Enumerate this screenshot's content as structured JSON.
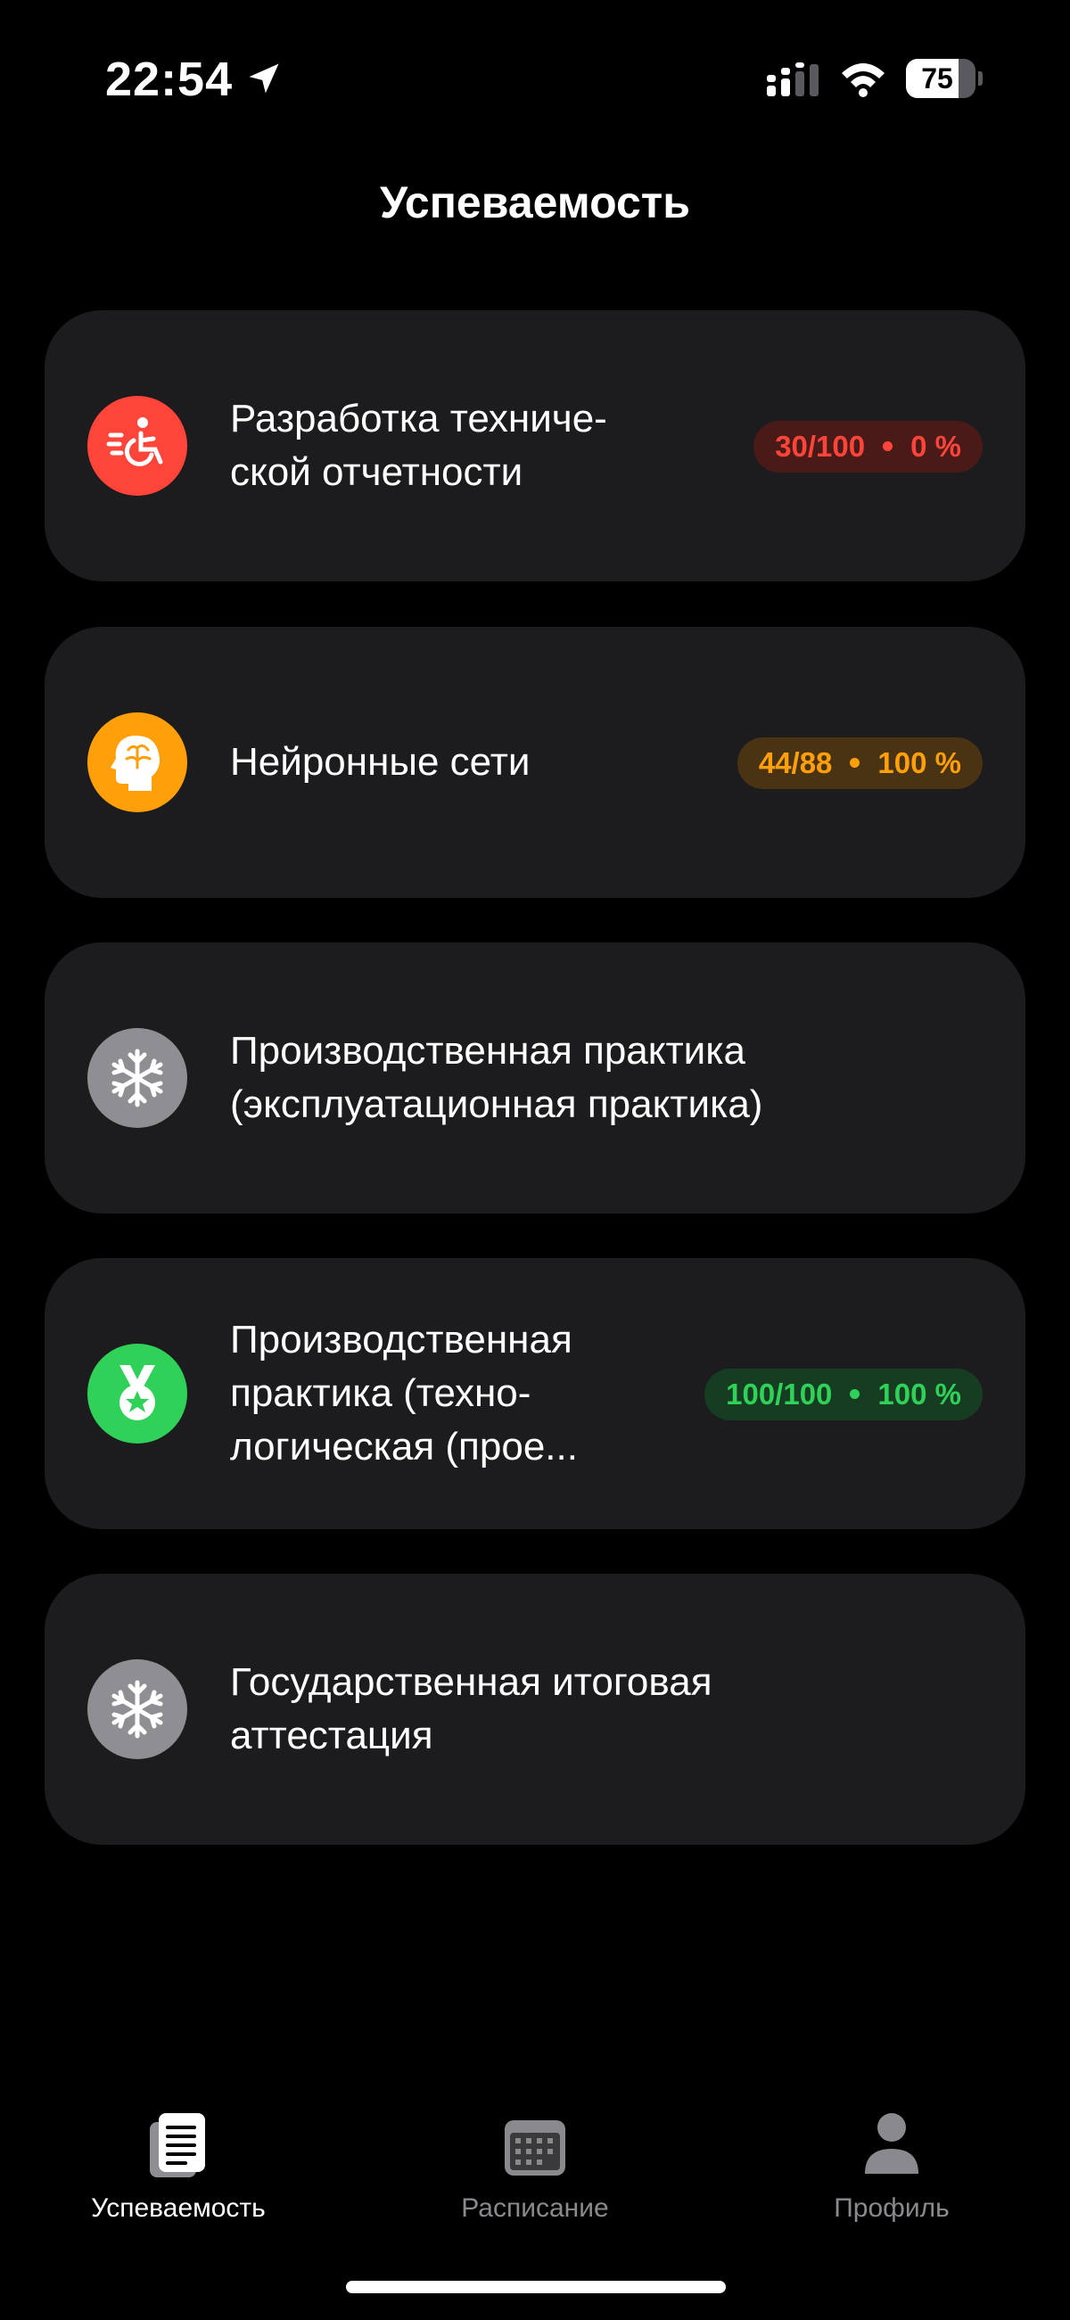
{
  "status_bar": {
    "time": "22:54",
    "battery_level": "75",
    "battery_percent": 75
  },
  "header": {
    "title": "Успеваемость"
  },
  "subjects": [
    {
      "name_lines": [
        "Разработка техниче-",
        "ской отчетности"
      ],
      "icon": "wheelchair-icon",
      "icon_color": "#ff453a",
      "badge": {
        "score": "30/100",
        "percent": "0 %",
        "color": "#ff453a"
      }
    },
    {
      "name_lines": [
        "Нейронные сети"
      ],
      "icon": "head-brain-icon",
      "icon_color": "#ff9f0a",
      "badge": {
        "score": "44/88",
        "percent": "100 %",
        "color": "#ff9f0a"
      }
    },
    {
      "name_lines": [
        "Производственная практика",
        "(эксплуатационная практика)"
      ],
      "icon": "snowflake-icon",
      "icon_color": "#8e8e93"
    },
    {
      "name_lines": [
        "Производственная",
        "практика (техно-",
        "логическая (прое..."
      ],
      "icon": "medal-icon",
      "icon_color": "#30d158",
      "badge": {
        "score": "100/100",
        "percent": "100 %",
        "color": "#30d158"
      }
    },
    {
      "name_lines": [
        "Государственная итоговая",
        "аттестация"
      ],
      "icon": "snowflake-icon",
      "icon_color": "#8e8e93"
    }
  ],
  "tab_bar": {
    "tabs": [
      {
        "label": "Успеваемость",
        "icon": "document-icon",
        "active": true
      },
      {
        "label": "Расписание",
        "icon": "calendar-icon",
        "active": false
      },
      {
        "label": "Профиль",
        "icon": "person-icon",
        "active": false
      }
    ]
  }
}
